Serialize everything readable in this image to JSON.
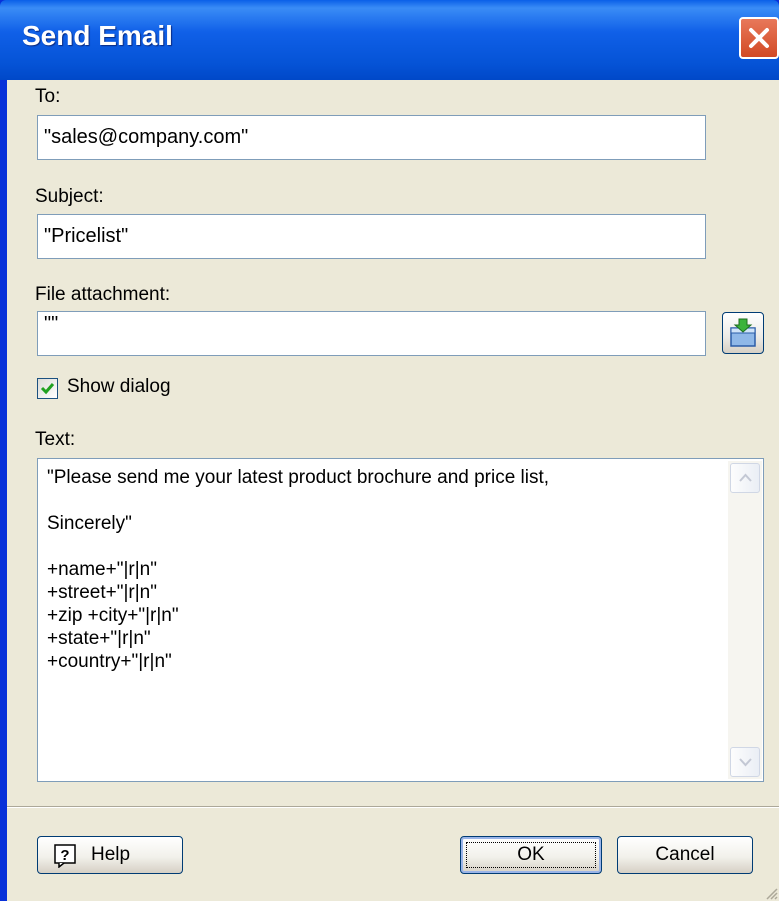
{
  "window": {
    "title": "Send Email",
    "close_icon": "close-icon"
  },
  "fields": {
    "to_label": "To:",
    "to_value": "\"sales@company.com\"",
    "subject_label": "Subject:",
    "subject_value": "\"Pricelist\"",
    "attachment_label": "File attachment:",
    "attachment_value": "\"\"",
    "browse_icon": "folder-browse-icon"
  },
  "show_dialog": {
    "label": "Show dialog",
    "checked": true
  },
  "text": {
    "label": "Text:",
    "lines": [
      "\"Please send me your latest product brochure and price list,",
      "",
      "Sincerely\"",
      "",
      "+name+\"|r|n\"",
      "+street+\"|r|n\"",
      "+zip +city+\"|r|n\"",
      "+state+\"|r|n\"",
      "+country+\"|r|n\""
    ]
  },
  "buttons": {
    "help": "Help",
    "ok": "OK",
    "cancel": "Cancel"
  },
  "colors": {
    "titlebar": "#0553d6",
    "dialog_face": "#ece9d8",
    "checkmark": "#21a121"
  }
}
